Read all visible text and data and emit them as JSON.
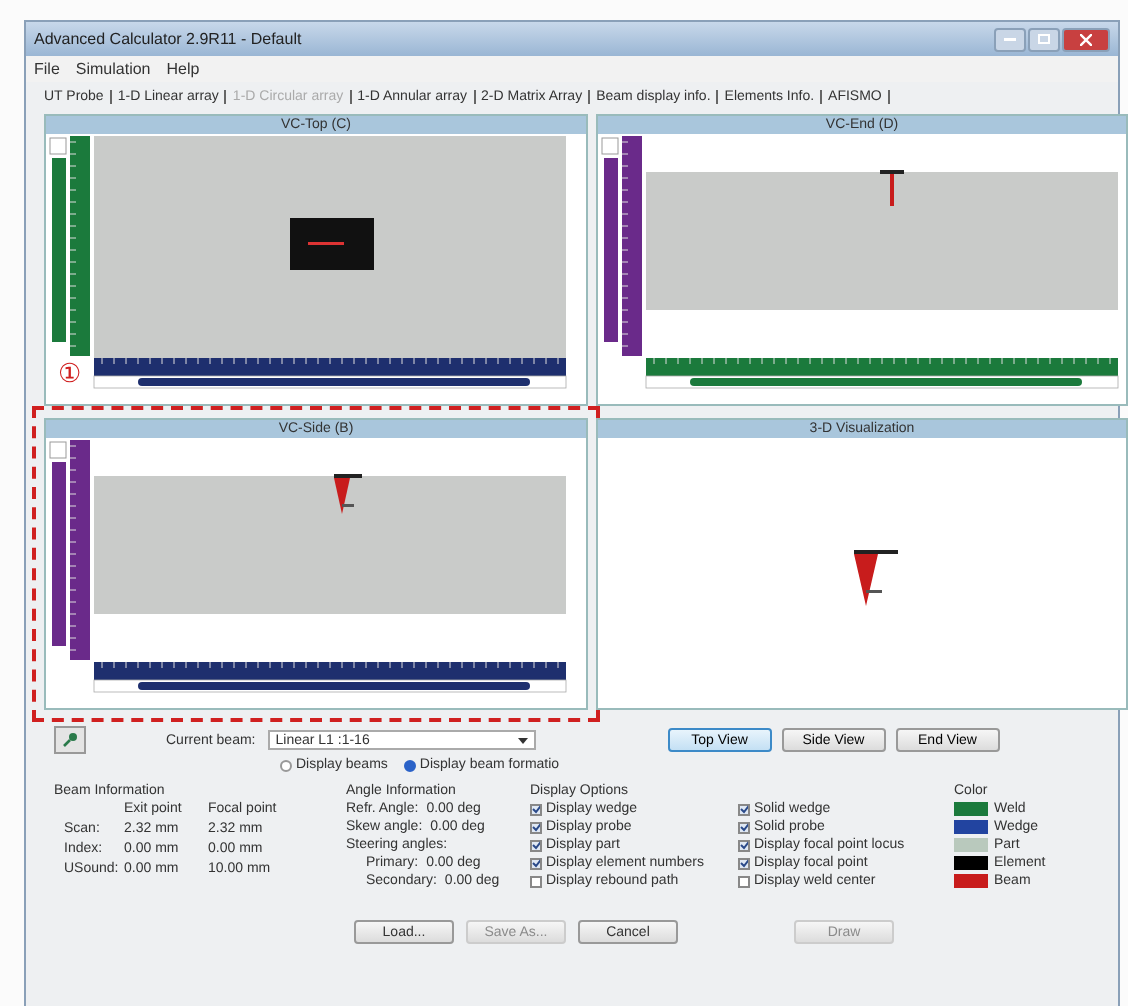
{
  "window": {
    "title": "Advanced Calculator 2.9R11 - Default"
  },
  "menu": [
    "File",
    "Simulation",
    "Help"
  ],
  "tabs": [
    {
      "label": "UT Probe",
      "disabled": false
    },
    {
      "label": "1-D Linear array",
      "disabled": false
    },
    {
      "label": "1-D Circular array",
      "disabled": true
    },
    {
      "label": "1-D Annular array",
      "disabled": false
    },
    {
      "label": "2-D Matrix Array",
      "disabled": false
    },
    {
      "label": "Beam display info.",
      "disabled": false
    },
    {
      "label": "Elements Info.",
      "disabled": false
    },
    {
      "label": "AFISMO",
      "disabled": false
    }
  ],
  "views": [
    {
      "title": "VC-Top (C)",
      "kind": "top",
      "highlighted": false
    },
    {
      "title": "VC-End (D)",
      "kind": "end",
      "highlighted": false
    },
    {
      "title": "VC-Side (B)",
      "kind": "side",
      "highlighted": true
    },
    {
      "title": "3-D Visualization",
      "kind": "perspective",
      "highlighted": false
    }
  ],
  "annotation": {
    "marker": "①"
  },
  "current_beam": {
    "label": "Current beam:",
    "value": "Linear  L1 :1-16"
  },
  "display_mode": [
    {
      "label": "Display beams",
      "selected": false
    },
    {
      "label": "Display beam formatio",
      "selected": true
    }
  ],
  "view_buttons": [
    {
      "label": "Top View",
      "selected": true
    },
    {
      "label": "Side View",
      "selected": false
    },
    {
      "label": "End View",
      "selected": false
    }
  ],
  "beam_info": {
    "title": "Beam Information",
    "headers": [
      "Exit point",
      "Focal point"
    ],
    "rows": [
      {
        "label": "Scan:",
        "exit": "2.32 mm",
        "focal": "2.32 mm"
      },
      {
        "label": "Index:",
        "exit": "0.00 mm",
        "focal": "0.00 mm"
      },
      {
        "label": "USound:",
        "exit": "0.00 mm",
        "focal": "10.00 mm"
      }
    ]
  },
  "angle_info": {
    "title": "Angle Information",
    "items": [
      {
        "label": "Refr. Angle:",
        "value": "0.00 deg"
      },
      {
        "label": "Skew angle:",
        "value": "0.00 deg"
      }
    ],
    "steering_title": "Steering angles:",
    "steering": [
      {
        "label": "Primary:",
        "value": "0.00 deg"
      },
      {
        "label": "Secondary:",
        "value": "0.00 deg"
      }
    ]
  },
  "display_options": {
    "title": "Display Options",
    "columns": [
      [
        {
          "label": "Display wedge",
          "checked": true
        },
        {
          "label": "Display probe",
          "checked": true
        },
        {
          "label": "Display part",
          "checked": true
        },
        {
          "label": "Display element numbers",
          "checked": true
        },
        {
          "label": "Display rebound path",
          "checked": false
        }
      ],
      [
        {
          "label": "Solid wedge",
          "checked": true
        },
        {
          "label": "Solid probe",
          "checked": true
        },
        {
          "label": "Display focal point locus",
          "checked": true
        },
        {
          "label": "Display focal point",
          "checked": true
        },
        {
          "label": "Display weld center",
          "checked": false
        }
      ]
    ]
  },
  "color": {
    "title": "Color",
    "items": [
      {
        "label": "Weld",
        "color": "#1b7a3c"
      },
      {
        "label": "Wedge",
        "color": "#2244a0"
      },
      {
        "label": "Part",
        "color": "#b9c9bd"
      },
      {
        "label": "Element",
        "color": "#000000"
      },
      {
        "label": "Beam",
        "color": "#c81c1c"
      }
    ]
  },
  "buttons": [
    {
      "label": "Load...",
      "disabled": false
    },
    {
      "label": "Save As...",
      "disabled": true
    },
    {
      "label": "Cancel",
      "disabled": false
    },
    {
      "label": "Draw",
      "disabled": true
    }
  ]
}
